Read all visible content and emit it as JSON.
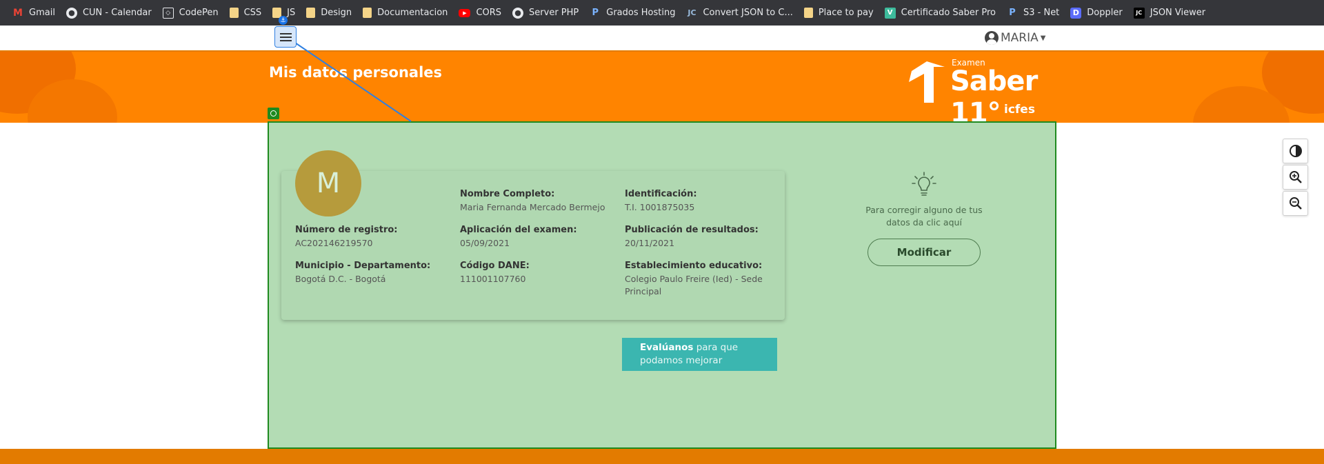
{
  "bookmarks": [
    {
      "label": "Gmail",
      "icon": "gmail-icon"
    },
    {
      "label": "CUN - Calendar",
      "icon": "globe-icon"
    },
    {
      "label": "CodePen",
      "icon": "codepen-icon"
    },
    {
      "label": "CSS",
      "icon": "folder-icon"
    },
    {
      "label": "JS",
      "icon": "folder-icon"
    },
    {
      "label": "Design",
      "icon": "folder-icon"
    },
    {
      "label": "Documentacion",
      "icon": "folder-icon"
    },
    {
      "label": "CORS",
      "icon": "youtube-icon"
    },
    {
      "label": "Server PHP",
      "icon": "globe-icon"
    },
    {
      "label": "Grados Hosting",
      "icon": "p-icon"
    },
    {
      "label": "Convert JSON to C...",
      "icon": "cj-icon"
    },
    {
      "label": "Place to pay",
      "icon": "folder-icon"
    },
    {
      "label": "Certificado Saber Pro",
      "icon": "v-icon"
    },
    {
      "label": "S3 - Net",
      "icon": "p-icon"
    },
    {
      "label": "Doppler",
      "icon": "doppler-icon"
    },
    {
      "label": "JSON Viewer",
      "icon": "jc-icon"
    }
  ],
  "user": {
    "name": "MARIA"
  },
  "banner": {
    "title": "Mis datos personales"
  },
  "logo": {
    "examen": "Examen",
    "saber": "Saber 11°",
    "icfes": "icfes"
  },
  "profile": {
    "initial": "M",
    "fields": {
      "nombre": {
        "label": "Nombre Completo:",
        "value": "Maria Fernanda Mercado Bermejo"
      },
      "identificacion": {
        "label": "Identificación:",
        "value": "T.I. 1001875035"
      },
      "registro": {
        "label": "Número de registro:",
        "value": "AC202146219570"
      },
      "aplicacion": {
        "label": "Aplicación del examen:",
        "value": "05/09/2021"
      },
      "publicacion": {
        "label": "Publicación de resultados:",
        "value": "20/11/2021"
      },
      "municipio": {
        "label": "Municipio - Departamento:",
        "value": "Bogotá D.C. - Bogotá"
      },
      "dane": {
        "label": "Código DANE:",
        "value": "111001107760"
      },
      "establecimiento": {
        "label": "Establecimiento educativo:",
        "value": "Colegio Paulo Freire (Ied) - Sede Principal"
      }
    }
  },
  "tip": {
    "text": "Para corregir alguno de tus datos da clic aquí",
    "button": "Modificar"
  },
  "evaluate": {
    "bold": "Evalúanos",
    "rest": " para que podamos mejorar"
  },
  "colors": {
    "brand_orange": "#ff8400",
    "highlight_green": "#b3dcb4",
    "teal": "#3bb6b0"
  }
}
